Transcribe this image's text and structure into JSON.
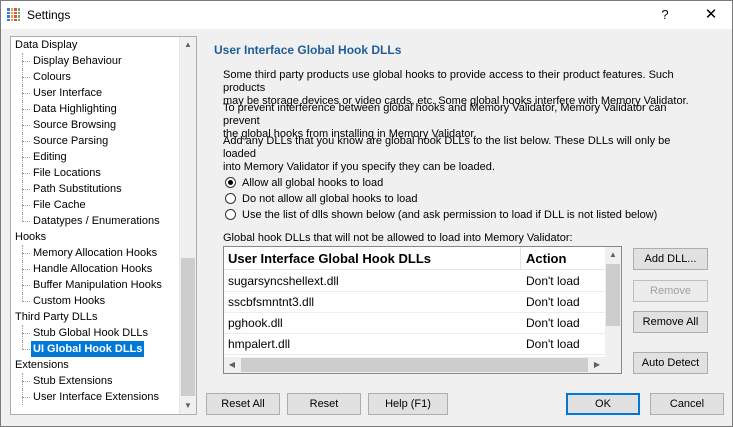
{
  "window": {
    "title": "Settings",
    "help_glyph": "?",
    "close_glyph": "✕"
  },
  "tree": {
    "items": [
      {
        "label": "Data Display",
        "level": 0
      },
      {
        "label": "Display Behaviour",
        "level": 1
      },
      {
        "label": "Colours",
        "level": 1
      },
      {
        "label": "User Interface",
        "level": 1
      },
      {
        "label": "Data Highlighting",
        "level": 1
      },
      {
        "label": "Source Browsing",
        "level": 1
      },
      {
        "label": "Source Parsing",
        "level": 1
      },
      {
        "label": "Editing",
        "level": 1
      },
      {
        "label": "File Locations",
        "level": 1
      },
      {
        "label": "Path Substitutions",
        "level": 1
      },
      {
        "label": "File Cache",
        "level": 1
      },
      {
        "label": "Datatypes / Enumerations",
        "level": 1,
        "last": true
      },
      {
        "label": "Hooks",
        "level": 0
      },
      {
        "label": "Memory Allocation Hooks",
        "level": 1
      },
      {
        "label": "Handle Allocation Hooks",
        "level": 1
      },
      {
        "label": "Buffer Manipulation Hooks",
        "level": 1
      },
      {
        "label": "Custom Hooks",
        "level": 1,
        "last": true
      },
      {
        "label": "Third Party DLLs",
        "level": 0
      },
      {
        "label": "Stub Global Hook DLLs",
        "level": 1
      },
      {
        "label": "UI Global Hook DLLs",
        "level": 1,
        "last": true,
        "selected": true
      },
      {
        "label": "Extensions",
        "level": 0
      },
      {
        "label": "Stub Extensions",
        "level": 1
      },
      {
        "label": "User Interface Extensions",
        "level": 1
      }
    ]
  },
  "panel": {
    "heading": "User Interface Global Hook DLLs",
    "para1_line1": "Some third party products use global hooks to provide access to their product features. Such products",
    "para1_line2": "may be storage devices or video cards, etc. Some global hooks interfere with Memory Validator.",
    "para2_line1": "To prevent interference between global hooks and Memory Validator, Memory Validator can prevent",
    "para2_line2": "the global hooks from installing in Memory Validator.",
    "para3_line1": "Add any DLLs that you know are global hook DLLs to the list below. These DLLs will only be loaded",
    "para3_line2": "into Memory Validator if you specify they can be loaded.",
    "radios": [
      {
        "label": "Allow all global hooks to load",
        "checked": true
      },
      {
        "label": "Do not allow all global hooks to load",
        "checked": false
      },
      {
        "label": "Use the list of dlls shown below (and ask permission to load if DLL is not listed below)",
        "checked": false
      }
    ],
    "list_caption": "Global hook DLLs that will not be allowed to load into Memory Validator:",
    "list": {
      "columns": [
        "User Interface Global Hook DLLs",
        "Action"
      ],
      "rows": [
        [
          "sugarsyncshellext.dll",
          "Don't load"
        ],
        [
          "sscbfsmntnt3.dll",
          "Don't load"
        ],
        [
          "pghook.dll",
          "Don't load"
        ],
        [
          "hmpalert.dll",
          "Don't load"
        ]
      ]
    },
    "buttons": {
      "add": "Add DLL...",
      "remove": "Remove",
      "remove_all": "Remove All",
      "auto_detect": "Auto Detect"
    }
  },
  "footer": {
    "reset_all": "Reset All",
    "reset": "Reset",
    "help": "Help (F1)",
    "ok": "OK",
    "cancel": "Cancel"
  },
  "colors": {
    "accent": "#0078d7",
    "heading": "#1f5d99",
    "icon_grid": [
      "#3c78d8",
      "#e8a33a",
      "#d9534f",
      "#5cb85c"
    ]
  }
}
